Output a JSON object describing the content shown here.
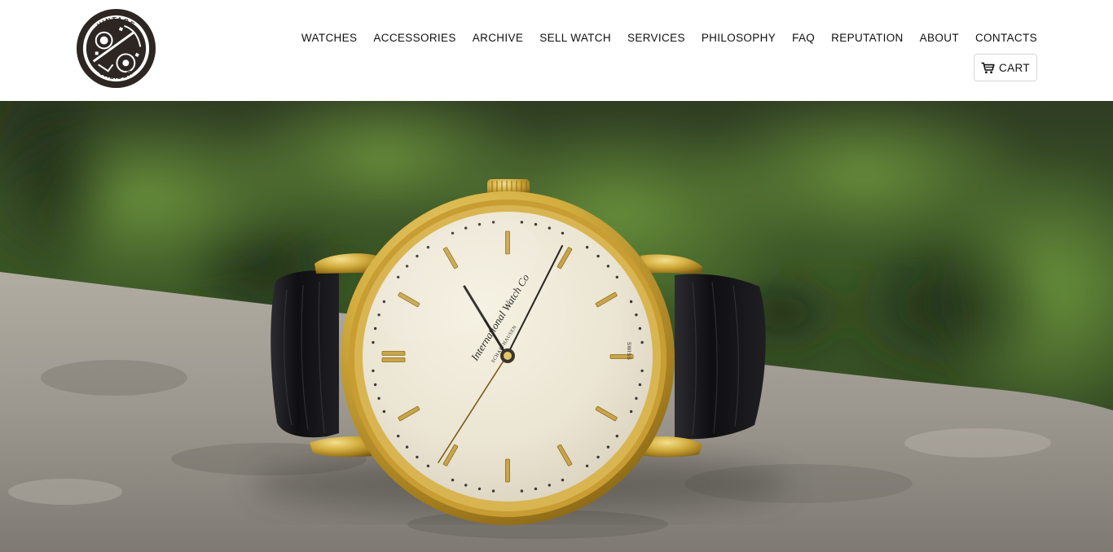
{
  "header": {
    "logo": {
      "icon": "vintage-caliber-logo-icon",
      "text_top": "VINTAGE",
      "text_bottom": "CALIBER"
    },
    "nav": [
      {
        "label": "WATCHES",
        "slug": "watches"
      },
      {
        "label": "ACCESSORIES",
        "slug": "accessories"
      },
      {
        "label": "ARCHIVE",
        "slug": "archive"
      },
      {
        "label": "SELL WATCH",
        "slug": "sell-watch"
      },
      {
        "label": "SERVICES",
        "slug": "services"
      },
      {
        "label": "PHILOSOPHY",
        "slug": "philosophy"
      },
      {
        "label": "FAQ",
        "slug": "faq"
      },
      {
        "label": "REPUTATION",
        "slug": "reputation"
      },
      {
        "label": "ABOUT",
        "slug": "about"
      },
      {
        "label": "CONTACTS",
        "slug": "contacts"
      }
    ],
    "cart": {
      "label": "CART",
      "icon": "cart-icon"
    }
  },
  "hero": {
    "image": "hero-watch-photo",
    "dial_brand": "International Watch Co",
    "dial_city": "SCHAFFHAUSEN",
    "dial_marking": "SWISS"
  },
  "colors": {
    "logo_dark": "#2d2622",
    "nav_text": "#111111",
    "cart_border": "#d7d7d7",
    "gold_case": "#d3ae3f",
    "dial": "#ebe5d3",
    "strap": "#121215",
    "foliage": "#3f6427",
    "stone": "#9c978f"
  }
}
